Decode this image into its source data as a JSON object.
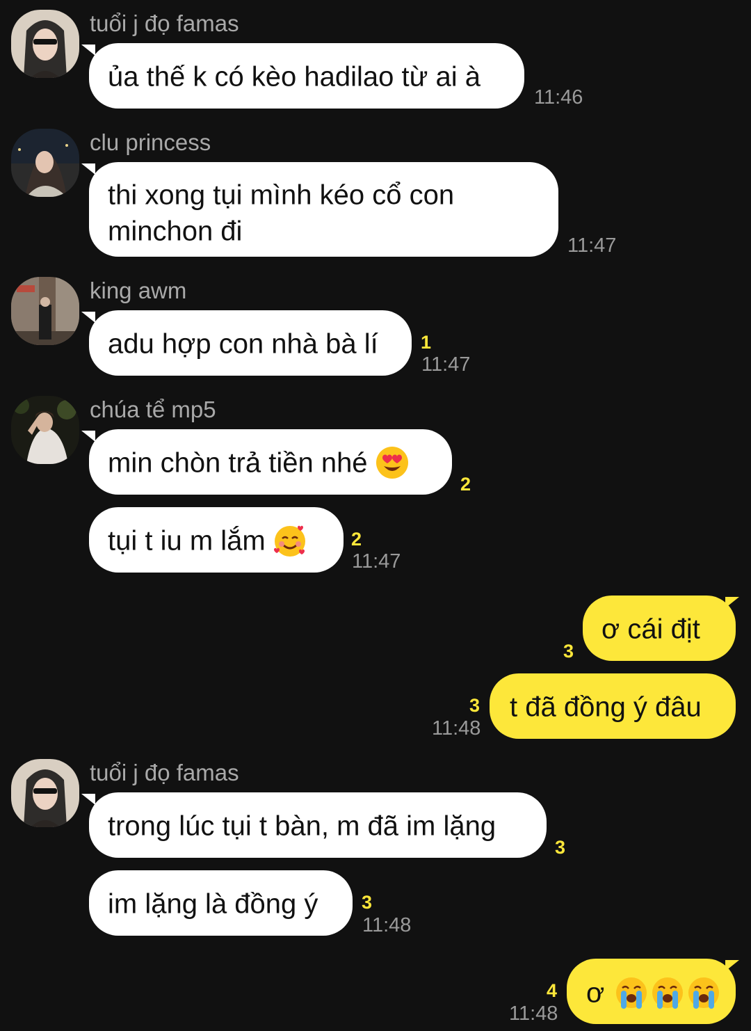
{
  "messages": [
    {
      "sender": "tuổi j đọ famas",
      "text": "ủa thế k có kèo hadilao từ ai à",
      "time": "11:46"
    },
    {
      "sender": "clu princess",
      "text": "thi xong tụi mình kéo cổ con minchon đi",
      "time": "11:47"
    },
    {
      "sender": "king awm",
      "text": "adu hợp con nhà bà lí",
      "unread": "1",
      "time": "11:47"
    },
    {
      "sender": "chúa tể mp5",
      "text": "min chòn trả tiền nhé",
      "emoji": "heart-eyes-emoji",
      "unread": "2"
    },
    {
      "text": "tụi t iu m lắm",
      "emoji": "smiling-hearts-emoji",
      "unread": "2",
      "time": "11:47"
    },
    {
      "outgoing": true,
      "text": "ơ cái địt",
      "unread": "3"
    },
    {
      "outgoing": true,
      "text": "t đã đồng ý đâu",
      "unread": "3",
      "time": "11:48"
    },
    {
      "sender": "tuổi j đọ famas",
      "text": "trong lúc tụi t bàn, m đã im lặng",
      "unread": "3"
    },
    {
      "text": "im lặng là đồng ý",
      "unread": "3",
      "time": "11:48"
    },
    {
      "outgoing": true,
      "text": "ơ",
      "emoji": "loudly-crying-emoji x3",
      "unread": "4",
      "time": "11:48"
    }
  ],
  "colors": {
    "background": "#111111",
    "incoming_bubble": "#ffffff",
    "outgoing_bubble": "#fde73a",
    "sender_name": "#a9a9a9",
    "timestamp": "#9a9a9a",
    "unread_count": "#fde73a"
  }
}
